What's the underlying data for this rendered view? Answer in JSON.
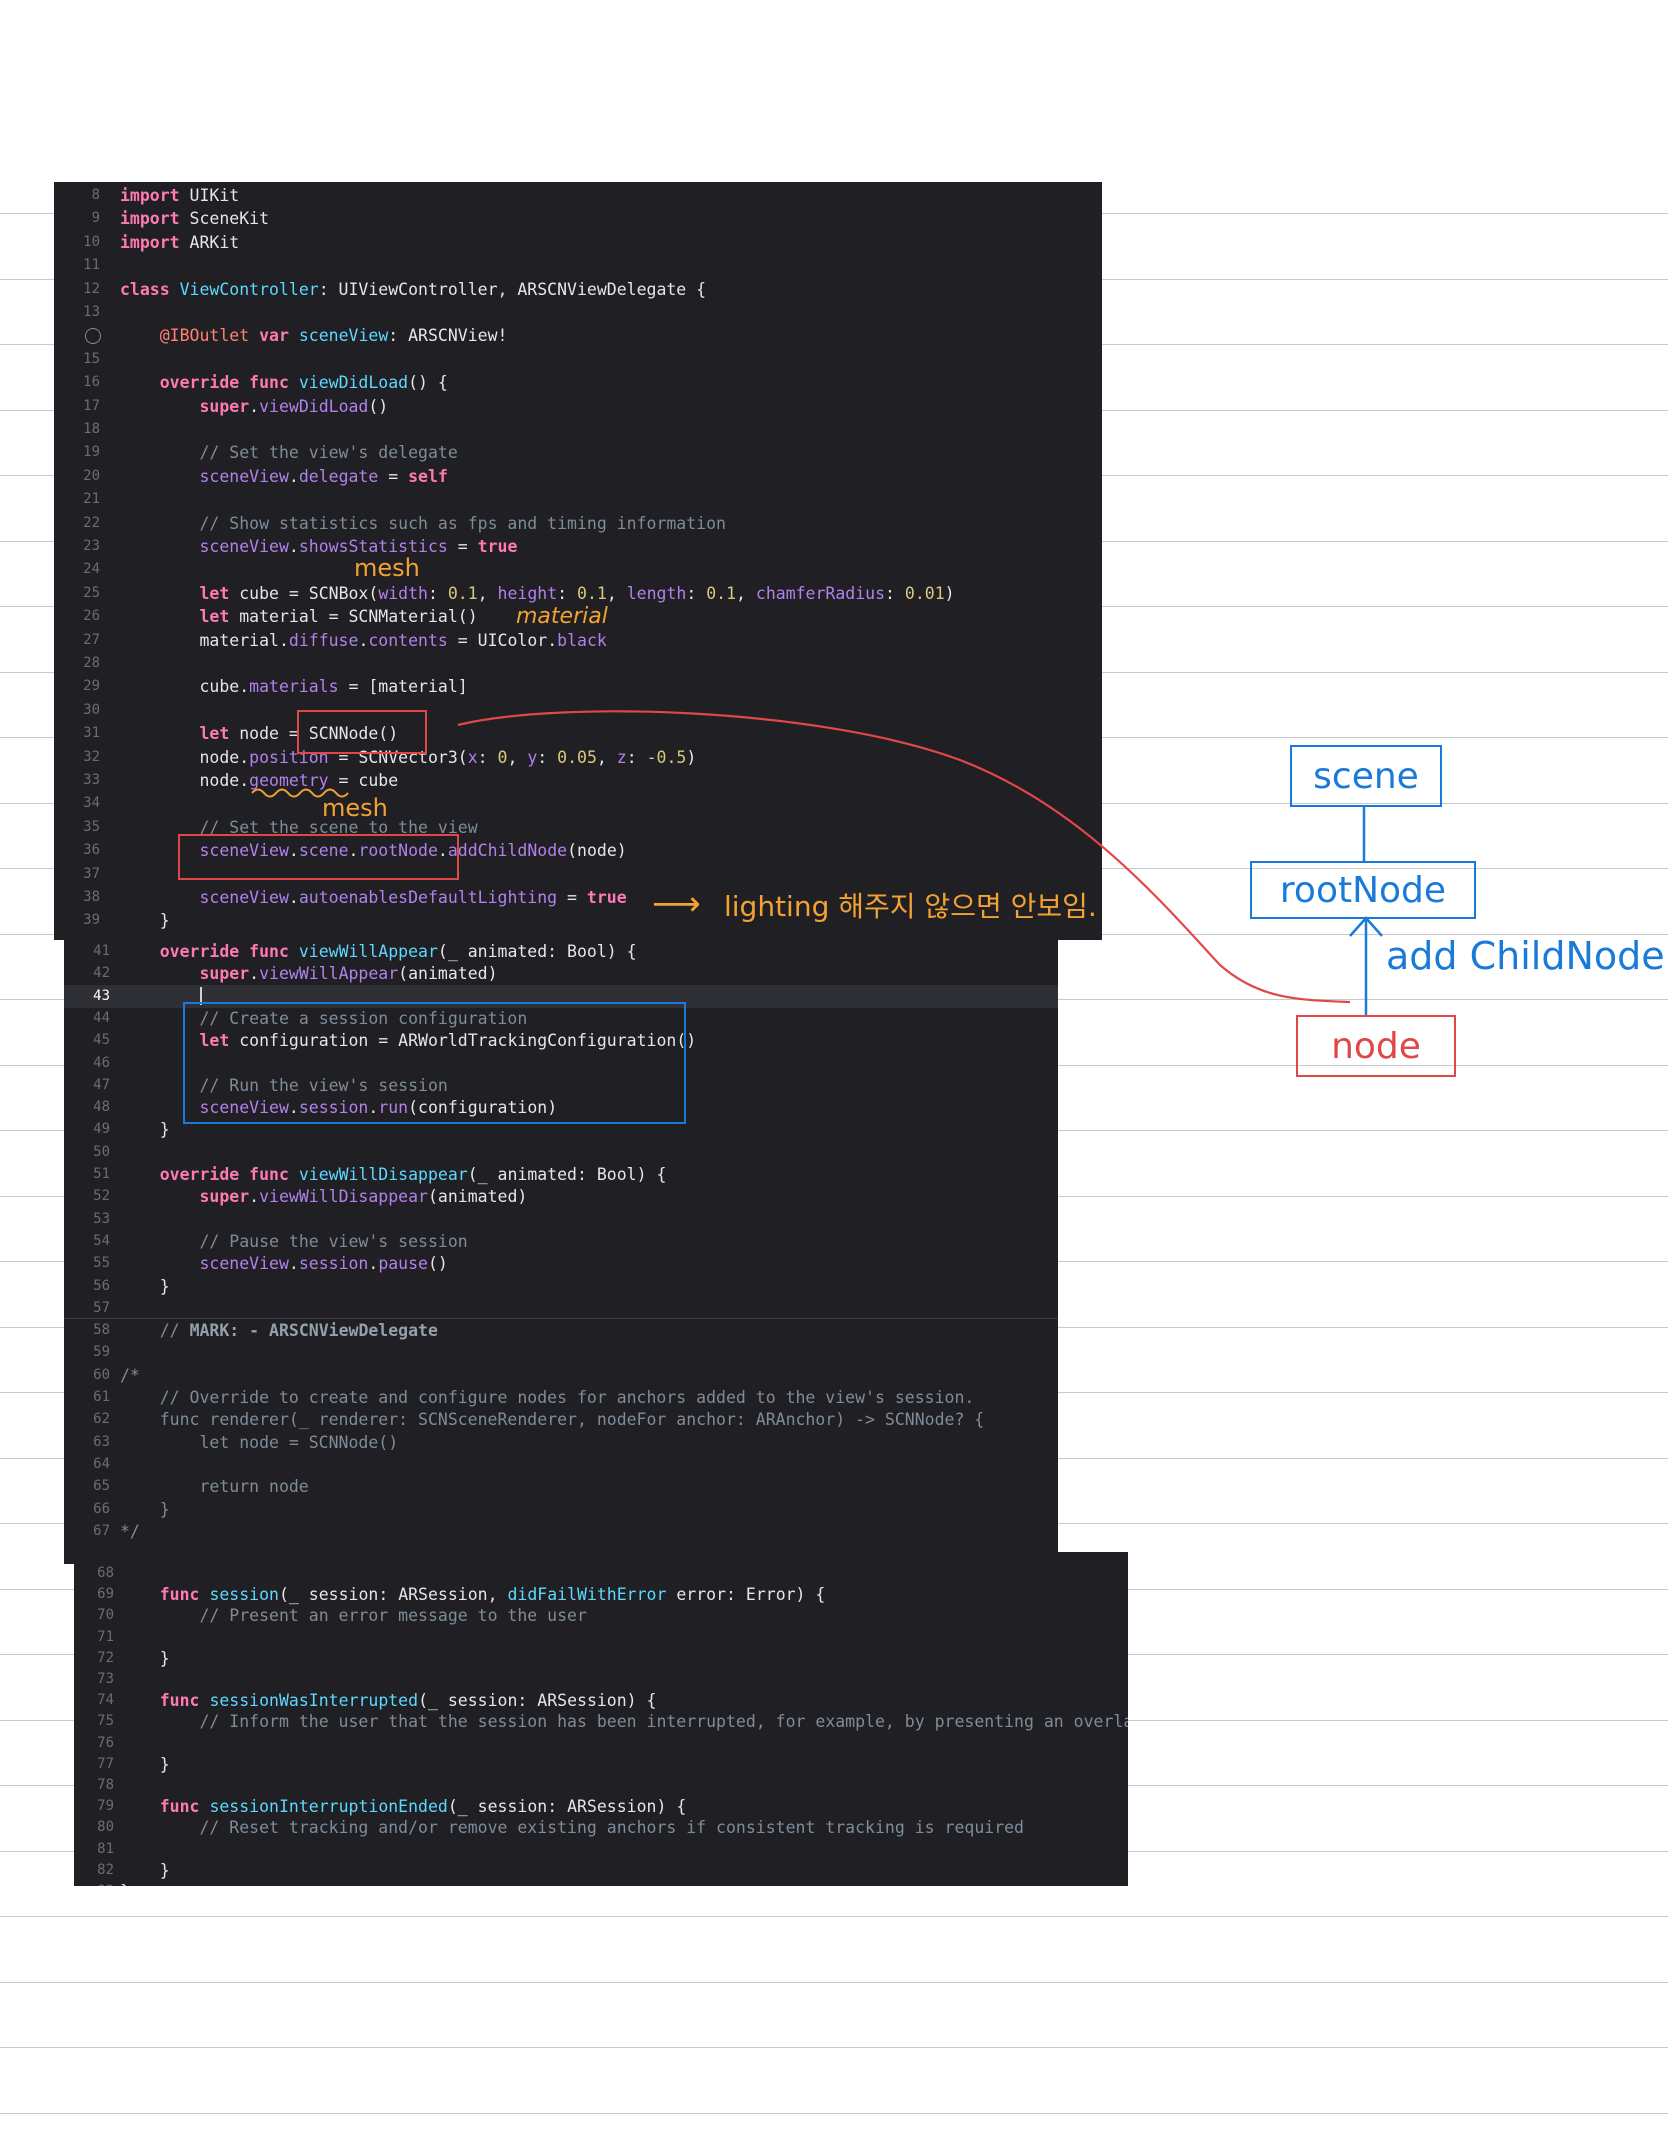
{
  "panel1": {
    "lines": [
      {
        "n": "8",
        "html": "<span class='kw'>import</span> UIKit"
      },
      {
        "n": "9",
        "html": "<span class='kw'>import</span> SceneKit"
      },
      {
        "n": "10",
        "html": "<span class='kw'>import</span> ARKit"
      },
      {
        "n": "11",
        "html": ""
      },
      {
        "n": "12",
        "html": "<span class='kw'>class</span> <span class='cls'>ViewController</span>: UIViewController, ARSCNViewDelegate {"
      },
      {
        "n": "13",
        "html": ""
      },
      {
        "n": "",
        "html": "    <span class='attr'>@IBOutlet</span> <span class='kw'>var</span> <span class='cls'>sceneView</span>: ARSCNView!"
      },
      {
        "n": "15",
        "html": ""
      },
      {
        "n": "16",
        "html": "    <span class='kw'>override func</span> <span class='cls'>viewDidLoad</span>() {"
      },
      {
        "n": "17",
        "html": "        <span class='kw'>super</span>.<span class='prop'>viewDidLoad</span>()"
      },
      {
        "n": "18",
        "html": ""
      },
      {
        "n": "19",
        "html": "        <span class='cmt'>// Set the view's delegate</span>"
      },
      {
        "n": "20",
        "html": "        <span class='prop'>sceneView</span>.<span class='prop'>delegate</span> = <span class='kw'>self</span>"
      },
      {
        "n": "21",
        "html": ""
      },
      {
        "n": "22",
        "html": "        <span class='cmt'>// Show statistics such as fps and timing information</span>"
      },
      {
        "n": "23",
        "html": "        <span class='prop'>sceneView</span>.<span class='prop'>showsStatistics</span> = <span class='kw'>true</span>"
      },
      {
        "n": "24",
        "html": ""
      },
      {
        "n": "25",
        "html": "        <span class='kw'>let</span> cube = SCNBox(<span class='prop'>width</span>: <span class='num'>0.1</span>, <span class='prop'>height</span>: <span class='num'>0.1</span>, <span class='prop'>length</span>: <span class='num'>0.1</span>, <span class='prop'>chamferRadius</span>: <span class='num'>0.01</span>)"
      },
      {
        "n": "26",
        "html": "        <span class='kw'>let</span> material = SCNMaterial()"
      },
      {
        "n": "27",
        "html": "        material.<span class='prop'>diffuse</span>.<span class='prop'>contents</span> = UIColor.<span class='prop'>black</span>"
      },
      {
        "n": "28",
        "html": ""
      },
      {
        "n": "29",
        "html": "        cube.<span class='prop'>materials</span> = [material]"
      },
      {
        "n": "30",
        "html": ""
      },
      {
        "n": "31",
        "html": "        <span class='kw'>let</span> node = SCNNode()"
      },
      {
        "n": "32",
        "html": "        node.<span class='prop'>position</span> = SCNVector3(<span class='prop'>x</span>: <span class='num'>0</span>, <span class='prop'>y</span>: <span class='num'>0.05</span>, <span class='prop'>z</span>: <span class='num'>-0.5</span>)"
      },
      {
        "n": "33",
        "html": "        node.<span class='prop'>geometry</span> = cube"
      },
      {
        "n": "34",
        "html": ""
      },
      {
        "n": "35",
        "html": "        <span class='cmt'>// Set the scene to the view</span>"
      },
      {
        "n": "36",
        "html": "        <span class='prop'>sceneView</span>.<span class='prop'>scene</span>.<span class='prop'>rootNode</span>.<span class='prop'>addChildNode</span>(node)"
      },
      {
        "n": "37",
        "html": ""
      },
      {
        "n": "38",
        "html": "        <span class='prop'>sceneView</span>.<span class='prop'>autoenablesDefaultLighting</span> = <span class='kw'>true</span>"
      },
      {
        "n": "39",
        "html": "    }"
      }
    ]
  },
  "panel2": {
    "lines": [
      {
        "n": "41",
        "html": "    <span class='kw'>override func</span> <span class='cls'>viewWillAppear</span>(_ animated: Bool) {"
      },
      {
        "n": "42",
        "html": "        <span class='kw'>super</span>.<span class='prop'>viewWillAppear</span>(animated)"
      },
      {
        "n": "43",
        "html": ""
      },
      {
        "n": "44",
        "html": "        <span class='cmt'>// Create a session configuration</span>"
      },
      {
        "n": "45",
        "html": "        <span class='kw'>let</span> configuration = ARWorldTrackingConfiguration()"
      },
      {
        "n": "46",
        "html": ""
      },
      {
        "n": "47",
        "html": "        <span class='cmt'>// Run the view's session</span>"
      },
      {
        "n": "48",
        "html": "        <span class='prop'>sceneView</span>.<span class='prop'>session</span>.<span class='prop'>run</span>(configuration)"
      },
      {
        "n": "49",
        "html": "    }"
      },
      {
        "n": "50",
        "html": ""
      },
      {
        "n": "51",
        "html": "    <span class='kw'>override func</span> <span class='cls'>viewWillDisappear</span>(_ animated: Bool) {"
      },
      {
        "n": "52",
        "html": "        <span class='kw'>super</span>.<span class='prop'>viewWillDisappear</span>(animated)"
      },
      {
        "n": "53",
        "html": ""
      },
      {
        "n": "54",
        "html": "        <span class='cmt'>// Pause the view's session</span>"
      },
      {
        "n": "55",
        "html": "        <span class='prop'>sceneView</span>.<span class='prop'>session</span>.<span class='prop'>pause</span>()"
      },
      {
        "n": "56",
        "html": "    }"
      },
      {
        "n": "57",
        "html": ""
      },
      {
        "n": "58",
        "html": "    <span class='cmt'>// </span><span class='mark'>MARK: - ARSCNViewDelegate</span>"
      },
      {
        "n": "59",
        "html": ""
      },
      {
        "n": "60",
        "html": "<span class='cmt'>/*</span>"
      },
      {
        "n": "61",
        "html": "<span class='cmt'>    // Override to create and configure nodes for anchors added to the view's session.</span>"
      },
      {
        "n": "62",
        "html": "<span class='cmt'>    func renderer(_ renderer: SCNSceneRenderer, nodeFor anchor: ARAnchor) -> SCNNode? {</span>"
      },
      {
        "n": "63",
        "html": "<span class='cmt'>        let node = SCNNode()</span>"
      },
      {
        "n": "64",
        "html": ""
      },
      {
        "n": "65",
        "html": "<span class='cmt'>        return node</span>"
      },
      {
        "n": "66",
        "html": "<span class='cmt'>    }</span>"
      },
      {
        "n": "67",
        "html": "<span class='cmt'>*/</span>"
      }
    ]
  },
  "panel3": {
    "lines": [
      {
        "n": "68",
        "html": ""
      },
      {
        "n": "69",
        "html": "    <span class='kw'>func</span> <span class='cls'>session</span>(_ session: ARSession, <span class='cls'>didFailWithError</span> error: Error) {"
      },
      {
        "n": "70",
        "html": "        <span class='cmt'>// Present an error message to the user</span>"
      },
      {
        "n": "71",
        "html": ""
      },
      {
        "n": "72",
        "html": "    }"
      },
      {
        "n": "73",
        "html": ""
      },
      {
        "n": "74",
        "html": "    <span class='kw'>func</span> <span class='cls'>sessionWasInterrupted</span>(_ session: ARSession) {"
      },
      {
        "n": "75",
        "html": "        <span class='cmt'>// Inform the user that the session has been interrupted, for example, by presenting an overlay</span>"
      },
      {
        "n": "76",
        "html": ""
      },
      {
        "n": "77",
        "html": "    }"
      },
      {
        "n": "78",
        "html": ""
      },
      {
        "n": "79",
        "html": "    <span class='kw'>func</span> <span class='cls'>sessionInterruptionEnded</span>(_ session: ARSession) {"
      },
      {
        "n": "80",
        "html": "        <span class='cmt'>// Reset tracking and/or remove existing anchors if consistent tracking is required</span>"
      },
      {
        "n": "81",
        "html": ""
      },
      {
        "n": "82",
        "html": "    }"
      },
      {
        "n": "83",
        "html": "}"
      }
    ]
  },
  "annotations": {
    "mesh_top": "mesh",
    "material": "material",
    "mesh_bottom": "mesh",
    "lighting": "lighting 해주지 않으면 안보임.",
    "arrow_glyph": "⟶"
  },
  "diagram": {
    "scene": "scene",
    "root_node": "rootNode",
    "add_child_node": "add ChildNode",
    "node": "node"
  },
  "colors": {
    "editor_bg": "#1f1f24",
    "annotation_orange": "#f2a233",
    "annotation_red": "#e04848",
    "annotation_blue": "#1a7ad9"
  }
}
